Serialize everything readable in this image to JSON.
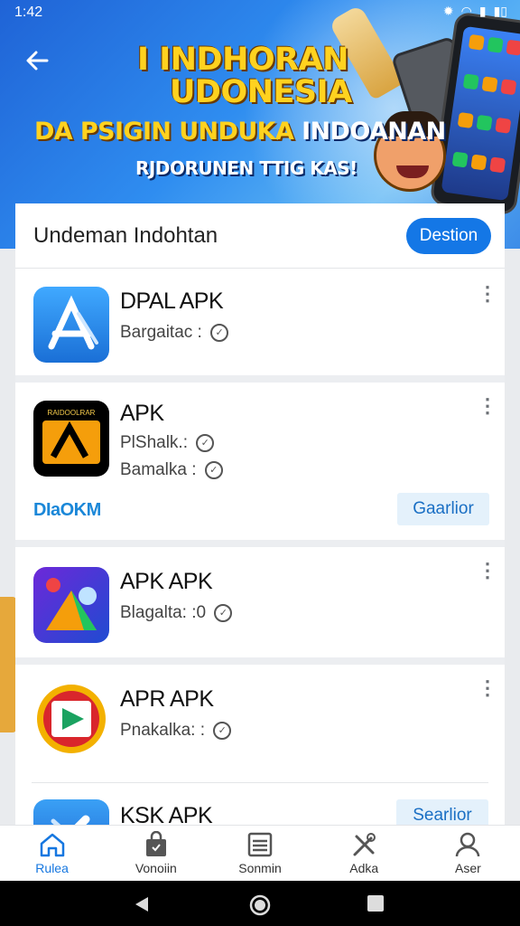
{
  "status": {
    "time": "1:42"
  },
  "hero": {
    "line1": "I INDHORAN",
    "line2": "UDONESIA",
    "line3_yellow": "DA PSIGIN UNDUKA",
    "line3_white": "INDOANAN",
    "line4": "RJDORUNEN TTIG KAS!"
  },
  "card": {
    "title": "Undeman Indohtan",
    "button": "Destion"
  },
  "items": [
    {
      "name": "DPAL APK",
      "meta1": "Bargaitac :"
    },
    {
      "name": "APK",
      "meta1": "PlShalk.:",
      "meta2": "Bamalka :",
      "link": "DIaOKM",
      "action": "Gaarlior",
      "icon_text": "RAIDOOLRAR"
    },
    {
      "name": "APK APK",
      "meta1": "Blagalta: :0"
    },
    {
      "name": "APR APK",
      "meta1": "Pnakalka: :"
    },
    {
      "name": "KSK APK",
      "action": "Searlior"
    }
  ],
  "bottom_nav": [
    {
      "label": "Rulea",
      "icon": "home-icon"
    },
    {
      "label": "Vonoiin",
      "icon": "bag-icon"
    },
    {
      "label": "Sonmin",
      "icon": "list-icon"
    },
    {
      "label": "Adka",
      "icon": "tools-icon"
    },
    {
      "label": "Aser",
      "icon": "user-icon"
    }
  ],
  "colors": {
    "primary": "#1477e6",
    "accent": "#ffd21f",
    "link": "#1a87d8"
  }
}
